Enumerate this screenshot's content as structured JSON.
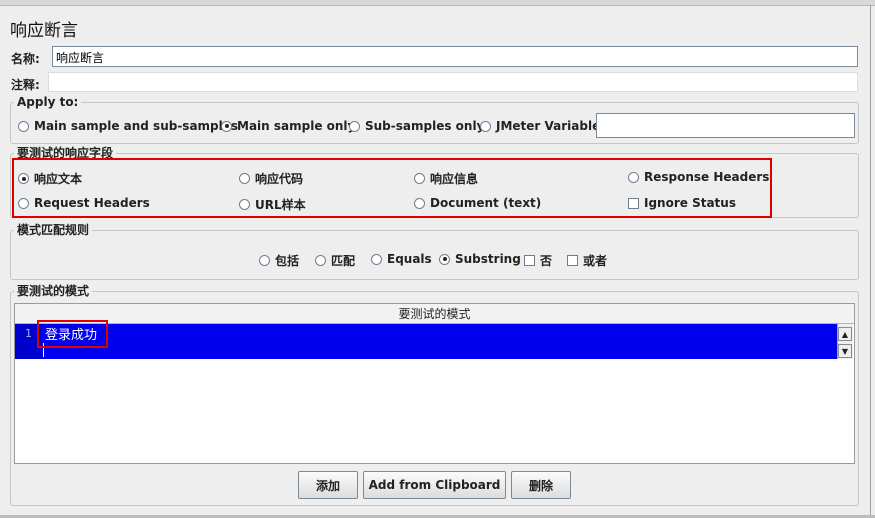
{
  "panel": {
    "title": "响应断言"
  },
  "name_field": {
    "label": "名称:",
    "value": "响应断言"
  },
  "comment_field": {
    "label": "注释:",
    "value": ""
  },
  "apply_to": {
    "legend": "Apply to:",
    "options": [
      {
        "label": "Main sample and sub-samples",
        "selected": false
      },
      {
        "label": "Main sample only",
        "selected": true
      },
      {
        "label": "Sub-samples only",
        "selected": false
      },
      {
        "label": "JMeter Variable",
        "selected": false
      }
    ],
    "variable_value": ""
  },
  "response_field": {
    "legend": "要测试的响应字段",
    "options": [
      {
        "label": "响应文本",
        "selected": true
      },
      {
        "label": "响应代码",
        "selected": false
      },
      {
        "label": "响应信息",
        "selected": false
      },
      {
        "label": "Response Headers",
        "selected": false
      },
      {
        "label": "Request Headers",
        "selected": false
      },
      {
        "label": "URL样本",
        "selected": false
      },
      {
        "label": "Document (text)",
        "selected": false
      }
    ],
    "ignore_status": {
      "label": "Ignore Status",
      "checked": false
    }
  },
  "pattern_rules": {
    "legend": "模式匹配规则",
    "options": [
      {
        "label": "包括",
        "selected": false
      },
      {
        "label": "匹配",
        "selected": false
      },
      {
        "label": "Equals",
        "selected": false
      },
      {
        "label": "Substring",
        "selected": true
      }
    ],
    "not": {
      "label": "否",
      "checked": false
    },
    "or": {
      "label": "或者",
      "checked": false
    }
  },
  "patterns": {
    "legend": "要测试的模式",
    "column_header": "要测试的模式",
    "rows": [
      {
        "line": "1",
        "text": "登录成功"
      }
    ]
  },
  "buttons": {
    "add": "添加",
    "add_clipboard": "Add from Clipboard",
    "delete": "删除"
  },
  "colors": {
    "selection": "#0000ee",
    "highlight": "#e00000"
  }
}
